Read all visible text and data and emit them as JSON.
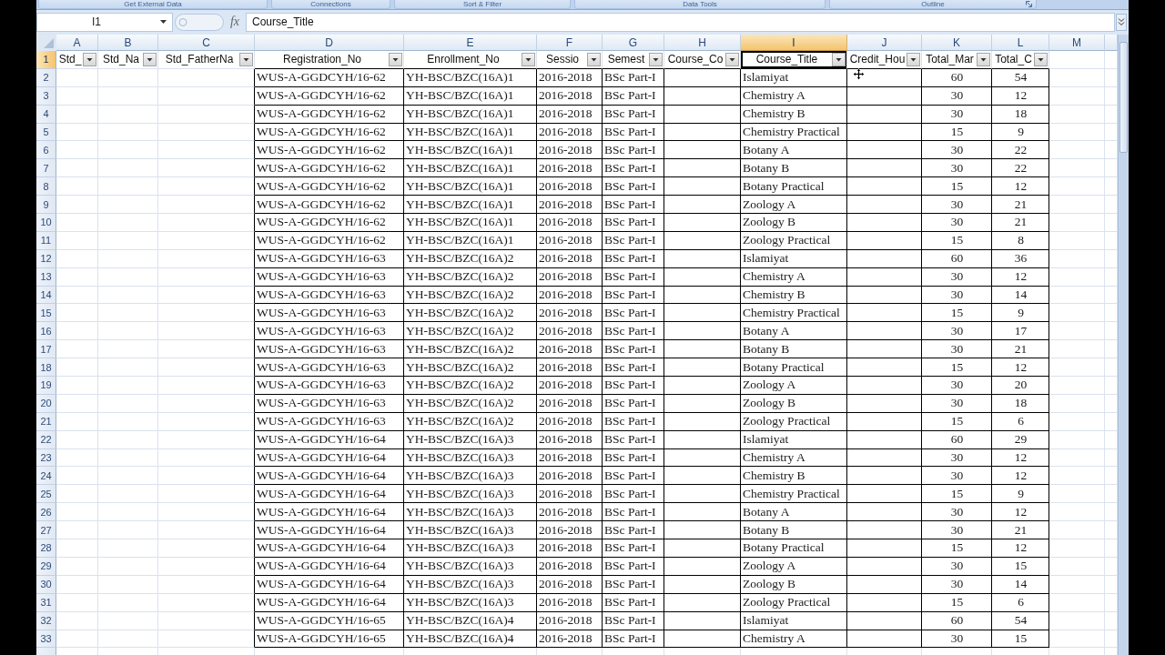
{
  "ribbon": {
    "groups": [
      {
        "label": "Get External Data",
        "launcher": false
      },
      {
        "label": "Connections",
        "launcher": false
      },
      {
        "label": "Sort & Filter",
        "launcher": false
      },
      {
        "label": "Data Tools",
        "launcher": false
      },
      {
        "label": "Outline",
        "launcher": true
      }
    ]
  },
  "formula_bar": {
    "name_box": "I1",
    "function_button": "fx",
    "formula": "Course_Title"
  },
  "sheet": {
    "columns": [
      {
        "letter": "A",
        "selected": false,
        "kind": "text",
        "bordered": false
      },
      {
        "letter": "B",
        "selected": false,
        "kind": "text",
        "bordered": false
      },
      {
        "letter": "C",
        "selected": false,
        "kind": "text",
        "bordered": false
      },
      {
        "letter": "D",
        "selected": false,
        "kind": "text",
        "bordered": true
      },
      {
        "letter": "E",
        "selected": false,
        "kind": "text",
        "bordered": true
      },
      {
        "letter": "F",
        "selected": false,
        "kind": "text",
        "bordered": true
      },
      {
        "letter": "G",
        "selected": false,
        "kind": "text",
        "bordered": true
      },
      {
        "letter": "H",
        "selected": false,
        "kind": "text",
        "bordered": true
      },
      {
        "letter": "I",
        "selected": true,
        "kind": "text",
        "bordered": true
      },
      {
        "letter": "J",
        "selected": false,
        "kind": "text",
        "bordered": true
      },
      {
        "letter": "K",
        "selected": false,
        "kind": "number",
        "bordered": true
      },
      {
        "letter": "L",
        "selected": false,
        "kind": "number",
        "bordered": true
      },
      {
        "letter": "M",
        "selected": false,
        "kind": "text",
        "bordered": false
      }
    ],
    "rows": [
      {
        "number": "1",
        "selected": true,
        "kind": "header",
        "cells": [
          "Std_",
          "Std_Na",
          "Std_FatherNa",
          "Registration_No",
          "Enrollment_No",
          "Sessio",
          "Semest",
          "Course_Co",
          "Course_Title",
          "Credit_Hou",
          "Total_Mar",
          "Total_C"
        ]
      },
      {
        "number": "2",
        "selected": false,
        "kind": "data",
        "cells": [
          null,
          null,
          null,
          "WUS-A-GGDCYH/16-62",
          "YH-BSC/BZC(16A)1",
          "2016-2018",
          "BSc Part-I",
          null,
          "Islamiyat",
          null,
          "60",
          "54"
        ]
      },
      {
        "number": "3",
        "selected": false,
        "kind": "data",
        "cells": [
          null,
          null,
          null,
          "WUS-A-GGDCYH/16-62",
          "YH-BSC/BZC(16A)1",
          "2016-2018",
          "BSc Part-I",
          null,
          "Chemistry A",
          null,
          "30",
          "12"
        ]
      },
      {
        "number": "4",
        "selected": false,
        "kind": "data",
        "cells": [
          null,
          null,
          null,
          "WUS-A-GGDCYH/16-62",
          "YH-BSC/BZC(16A)1",
          "2016-2018",
          "BSc Part-I",
          null,
          "Chemistry B",
          null,
          "30",
          "18"
        ]
      },
      {
        "number": "5",
        "selected": false,
        "kind": "data",
        "cells": [
          null,
          null,
          null,
          "WUS-A-GGDCYH/16-62",
          "YH-BSC/BZC(16A)1",
          "2016-2018",
          "BSc Part-I",
          null,
          "Chemistry Practical",
          null,
          "15",
          "9"
        ]
      },
      {
        "number": "6",
        "selected": false,
        "kind": "data",
        "cells": [
          null,
          null,
          null,
          "WUS-A-GGDCYH/16-62",
          "YH-BSC/BZC(16A)1",
          "2016-2018",
          "BSc Part-I",
          null,
          "Botany A",
          null,
          "30",
          "22"
        ]
      },
      {
        "number": "7",
        "selected": false,
        "kind": "data",
        "cells": [
          null,
          null,
          null,
          "WUS-A-GGDCYH/16-62",
          "YH-BSC/BZC(16A)1",
          "2016-2018",
          "BSc Part-I",
          null,
          "Botany B",
          null,
          "30",
          "22"
        ]
      },
      {
        "number": "8",
        "selected": false,
        "kind": "data",
        "cells": [
          null,
          null,
          null,
          "WUS-A-GGDCYH/16-62",
          "YH-BSC/BZC(16A)1",
          "2016-2018",
          "BSc Part-I",
          null,
          "Botany Practical",
          null,
          "15",
          "12"
        ]
      },
      {
        "number": "9",
        "selected": false,
        "kind": "data",
        "cells": [
          null,
          null,
          null,
          "WUS-A-GGDCYH/16-62",
          "YH-BSC/BZC(16A)1",
          "2016-2018",
          "BSc Part-I",
          null,
          "Zoology A",
          null,
          "30",
          "21"
        ]
      },
      {
        "number": "10",
        "selected": false,
        "kind": "data",
        "cells": [
          null,
          null,
          null,
          "WUS-A-GGDCYH/16-62",
          "YH-BSC/BZC(16A)1",
          "2016-2018",
          "BSc Part-I",
          null,
          "Zoology B",
          null,
          "30",
          "21"
        ]
      },
      {
        "number": "11",
        "selected": false,
        "kind": "data",
        "cells": [
          null,
          null,
          null,
          "WUS-A-GGDCYH/16-62",
          "YH-BSC/BZC(16A)1",
          "2016-2018",
          "BSc Part-I",
          null,
          "Zoology Practical",
          null,
          "15",
          "8"
        ]
      },
      {
        "number": "12",
        "selected": false,
        "kind": "data",
        "cells": [
          null,
          null,
          null,
          "WUS-A-GGDCYH/16-63",
          "YH-BSC/BZC(16A)2",
          "2016-2018",
          "BSc Part-I",
          null,
          "Islamiyat",
          null,
          "60",
          "36"
        ]
      },
      {
        "number": "13",
        "selected": false,
        "kind": "data",
        "cells": [
          null,
          null,
          null,
          "WUS-A-GGDCYH/16-63",
          "YH-BSC/BZC(16A)2",
          "2016-2018",
          "BSc Part-I",
          null,
          "Chemistry A",
          null,
          "30",
          "12"
        ]
      },
      {
        "number": "14",
        "selected": false,
        "kind": "data",
        "cells": [
          null,
          null,
          null,
          "WUS-A-GGDCYH/16-63",
          "YH-BSC/BZC(16A)2",
          "2016-2018",
          "BSc Part-I",
          null,
          "Chemistry B",
          null,
          "30",
          "14"
        ]
      },
      {
        "number": "15",
        "selected": false,
        "kind": "data",
        "cells": [
          null,
          null,
          null,
          "WUS-A-GGDCYH/16-63",
          "YH-BSC/BZC(16A)2",
          "2016-2018",
          "BSc Part-I",
          null,
          "Chemistry Practical",
          null,
          "15",
          "9"
        ]
      },
      {
        "number": "16",
        "selected": false,
        "kind": "data",
        "cells": [
          null,
          null,
          null,
          "WUS-A-GGDCYH/16-63",
          "YH-BSC/BZC(16A)2",
          "2016-2018",
          "BSc Part-I",
          null,
          "Botany A",
          null,
          "30",
          "17"
        ]
      },
      {
        "number": "17",
        "selected": false,
        "kind": "data",
        "cells": [
          null,
          null,
          null,
          "WUS-A-GGDCYH/16-63",
          "YH-BSC/BZC(16A)2",
          "2016-2018",
          "BSc Part-I",
          null,
          "Botany B",
          null,
          "30",
          "21"
        ]
      },
      {
        "number": "18",
        "selected": false,
        "kind": "data",
        "cells": [
          null,
          null,
          null,
          "WUS-A-GGDCYH/16-63",
          "YH-BSC/BZC(16A)2",
          "2016-2018",
          "BSc Part-I",
          null,
          "Botany Practical",
          null,
          "15",
          "12"
        ]
      },
      {
        "number": "19",
        "selected": false,
        "kind": "data",
        "cells": [
          null,
          null,
          null,
          "WUS-A-GGDCYH/16-63",
          "YH-BSC/BZC(16A)2",
          "2016-2018",
          "BSc Part-I",
          null,
          "Zoology A",
          null,
          "30",
          "20"
        ]
      },
      {
        "number": "20",
        "selected": false,
        "kind": "data",
        "cells": [
          null,
          null,
          null,
          "WUS-A-GGDCYH/16-63",
          "YH-BSC/BZC(16A)2",
          "2016-2018",
          "BSc Part-I",
          null,
          "Zoology B",
          null,
          "30",
          "18"
        ]
      },
      {
        "number": "21",
        "selected": false,
        "kind": "data",
        "cells": [
          null,
          null,
          null,
          "WUS-A-GGDCYH/16-63",
          "YH-BSC/BZC(16A)2",
          "2016-2018",
          "BSc Part-I",
          null,
          "Zoology Practical",
          null,
          "15",
          "6"
        ]
      },
      {
        "number": "22",
        "selected": false,
        "kind": "data",
        "cells": [
          null,
          null,
          null,
          "WUS-A-GGDCYH/16-64",
          "YH-BSC/BZC(16A)3",
          "2016-2018",
          "BSc Part-I",
          null,
          "Islamiyat",
          null,
          "60",
          "29"
        ]
      },
      {
        "number": "23",
        "selected": false,
        "kind": "data",
        "cells": [
          null,
          null,
          null,
          "WUS-A-GGDCYH/16-64",
          "YH-BSC/BZC(16A)3",
          "2016-2018",
          "BSc Part-I",
          null,
          "Chemistry A",
          null,
          "30",
          "12"
        ]
      },
      {
        "number": "24",
        "selected": false,
        "kind": "data",
        "cells": [
          null,
          null,
          null,
          "WUS-A-GGDCYH/16-64",
          "YH-BSC/BZC(16A)3",
          "2016-2018",
          "BSc Part-I",
          null,
          "Chemistry B",
          null,
          "30",
          "12"
        ]
      },
      {
        "number": "25",
        "selected": false,
        "kind": "data",
        "cells": [
          null,
          null,
          null,
          "WUS-A-GGDCYH/16-64",
          "YH-BSC/BZC(16A)3",
          "2016-2018",
          "BSc Part-I",
          null,
          "Chemistry Practical",
          null,
          "15",
          "9"
        ]
      },
      {
        "number": "26",
        "selected": false,
        "kind": "data",
        "cells": [
          null,
          null,
          null,
          "WUS-A-GGDCYH/16-64",
          "YH-BSC/BZC(16A)3",
          "2016-2018",
          "BSc Part-I",
          null,
          "Botany A",
          null,
          "30",
          "12"
        ]
      },
      {
        "number": "27",
        "selected": false,
        "kind": "data",
        "cells": [
          null,
          null,
          null,
          "WUS-A-GGDCYH/16-64",
          "YH-BSC/BZC(16A)3",
          "2016-2018",
          "BSc Part-I",
          null,
          "Botany B",
          null,
          "30",
          "21"
        ]
      },
      {
        "number": "28",
        "selected": false,
        "kind": "data",
        "cells": [
          null,
          null,
          null,
          "WUS-A-GGDCYH/16-64",
          "YH-BSC/BZC(16A)3",
          "2016-2018",
          "BSc Part-I",
          null,
          "Botany Practical",
          null,
          "15",
          "12"
        ]
      },
      {
        "number": "29",
        "selected": false,
        "kind": "data",
        "cells": [
          null,
          null,
          null,
          "WUS-A-GGDCYH/16-64",
          "YH-BSC/BZC(16A)3",
          "2016-2018",
          "BSc Part-I",
          null,
          "Zoology A",
          null,
          "30",
          "15"
        ]
      },
      {
        "number": "30",
        "selected": false,
        "kind": "data",
        "cells": [
          null,
          null,
          null,
          "WUS-A-GGDCYH/16-64",
          "YH-BSC/BZC(16A)3",
          "2016-2018",
          "BSc Part-I",
          null,
          "Zoology B",
          null,
          "30",
          "14"
        ]
      },
      {
        "number": "31",
        "selected": false,
        "kind": "data",
        "cells": [
          null,
          null,
          null,
          "WUS-A-GGDCYH/16-64",
          "YH-BSC/BZC(16A)3",
          "2016-2018",
          "BSc Part-I",
          null,
          "Zoology Practical",
          null,
          "15",
          "6"
        ]
      },
      {
        "number": "32",
        "selected": false,
        "kind": "data",
        "cells": [
          null,
          null,
          null,
          "WUS-A-GGDCYH/16-65",
          "YH-BSC/BZC(16A)4",
          "2016-2018",
          "BSc Part-I",
          null,
          "Islamiyat",
          null,
          "60",
          "54"
        ]
      },
      {
        "number": "33",
        "selected": false,
        "kind": "data",
        "cells": [
          null,
          null,
          null,
          "WUS-A-GGDCYH/16-65",
          "YH-BSC/BZC(16A)4",
          "2016-2018",
          "BSc Part-I",
          null,
          "Chemistry A",
          null,
          "30",
          "15"
        ]
      }
    ]
  }
}
